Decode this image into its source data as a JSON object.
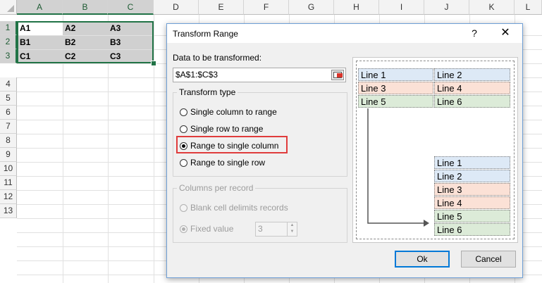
{
  "sheet": {
    "columns": [
      "A",
      "B",
      "C",
      "D",
      "E",
      "F",
      "G",
      "H",
      "I",
      "J",
      "K",
      "L"
    ],
    "rows": [
      "1",
      "2",
      "3",
      "4",
      "5",
      "6",
      "7",
      "8",
      "9",
      "10",
      "11",
      "12",
      "13"
    ],
    "cells": [
      [
        "A1",
        "A2",
        "A3"
      ],
      [
        "B1",
        "B2",
        "B3"
      ],
      [
        "C1",
        "C2",
        "C3"
      ]
    ]
  },
  "dialog": {
    "title": "Transform Range",
    "help": "?",
    "close": "✕",
    "data_label": "Data to be transformed:",
    "range_value": "$A$1:$C$3",
    "transform_type": {
      "label": "Transform type",
      "options": [
        "Single column to range",
        "Single row to range",
        "Range to single column",
        "Range to single row"
      ],
      "selected": "Range to single column"
    },
    "columns_per_record": {
      "label": "Columns per record",
      "blank": "Blank cell delimits records",
      "fixed": "Fixed value",
      "fixed_value": "3"
    },
    "preview": {
      "grid": [
        [
          "Line 1",
          "Line 2"
        ],
        [
          "Line 3",
          "Line 4"
        ],
        [
          "Line 5",
          "Line 6"
        ]
      ],
      "column": [
        "Line 1",
        "Line 2",
        "Line 3",
        "Line 4",
        "Line 5",
        "Line 6"
      ],
      "colors": {
        "blue": "#dde9f6",
        "pink": "#fbe1d6",
        "green": "#dcebd8"
      }
    },
    "ok": "Ok",
    "cancel": "Cancel"
  }
}
